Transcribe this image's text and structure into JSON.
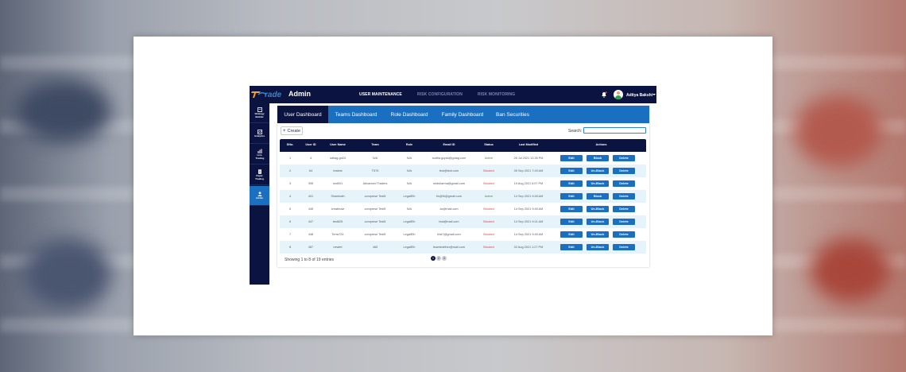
{
  "header": {
    "logo_text": "rade",
    "app_title": "Admin",
    "nav": [
      {
        "label": "USER MAINTENANCE",
        "active": true
      },
      {
        "label": "RISK CONFIGURATION",
        "active": false
      },
      {
        "label": "RISK MONITORING",
        "active": false
      }
    ],
    "user_name": "Aditya Bakshi"
  },
  "sidebar": {
    "items": [
      {
        "label": "Strategy Builder",
        "icon": "builder-icon",
        "active": false
      },
      {
        "label": "Analytics",
        "icon": "analytics-icon",
        "active": false
      },
      {
        "label": "Live Trading",
        "icon": "chart-icon",
        "active": false
      },
      {
        "label": "Paper Trading",
        "icon": "paper-icon",
        "active": false
      },
      {
        "label": "Admin",
        "icon": "admin-icon",
        "active": true
      }
    ]
  },
  "tabs": [
    {
      "label": "User Dashboard",
      "active": true
    },
    {
      "label": "Teams Dashboard",
      "active": false
    },
    {
      "label": "Role Dashboard",
      "active": false
    },
    {
      "label": "Family Dashboard",
      "active": false
    },
    {
      "label": "Ban Securities",
      "active": false
    }
  ],
  "toolbar": {
    "create_label": "Create",
    "search_label": "Search:",
    "search_value": ""
  },
  "table": {
    "columns": [
      "SNo.",
      "User ID",
      "User Name",
      "Team",
      "Role",
      "Email ID",
      "Status",
      "Last Modified",
      "Actions"
    ],
    "rows": [
      {
        "sno": "1",
        "user_id": "4",
        "user_name": "sdhag.gu03",
        "team": "N/A",
        "role": "N/A",
        "email": "sudha.gupta@gutag.com",
        "status": "Active",
        "last_modified": "28 Jul 2021 12:35 PM",
        "block_label": "Block"
      },
      {
        "sno": "2",
        "user_id": "64",
        "user_name": "testest",
        "team": "T575",
        "role": "N/A",
        "email": "test@test.com",
        "status": "Blocked",
        "last_modified": "05 Sep 2021 7:49 AM",
        "block_label": "Un-Block"
      },
      {
        "sno": "3",
        "user_id": "395",
        "user_name": "xed001",
        "team": "Advanced Traders",
        "role": "N/A",
        "email": "sridsharma@gmail.com",
        "status": "Blocked",
        "last_modified": "19 Aug 2021 6:07 PM",
        "block_label": "Un-Block"
      },
      {
        "sno": "4",
        "user_id": "401",
        "user_name": "Shanteath",
        "team": "comprese Test5",
        "role": "LegalEth",
        "email": "fin@th@gmail.com",
        "status": "Active",
        "last_modified": "14 Sep 2021 9:45 AM",
        "block_label": "Block"
      },
      {
        "sno": "5",
        "user_id": "445",
        "user_name": "createuse",
        "team": "comprese Test5",
        "role": "N/A",
        "email": "ac@mail.com",
        "status": "Blocked",
        "last_modified": "14 Sep 2021 9:45 AM",
        "block_label": "Un-Block"
      },
      {
        "sno": "6",
        "user_id": "447",
        "user_name": "test625",
        "team": "comprese Test5",
        "role": "LegalEth",
        "email": "test@mail.com",
        "status": "Blocked",
        "last_modified": "14 Sep 2021 9:41 AM",
        "block_label": "Un-Block"
      },
      {
        "sno": "7",
        "user_id": "448",
        "user_name": "Terra724",
        "team": "comprese Test5",
        "role": "LegalEth",
        "email": "test7@gmail.com",
        "status": "Blocked",
        "last_modified": "14 Sep 2021 9:45 AM",
        "block_label": "Un-Block"
      },
      {
        "sno": "8",
        "user_id": "467",
        "user_name": "newtet",
        "team": "465",
        "role": "LegalEth",
        "email": "teamtestther@mail.com",
        "status": "Blocked",
        "last_modified": "02 Aug 2021 1:27 PM",
        "block_label": "Un-Block"
      }
    ],
    "edit_label": "Edit",
    "delete_label": "Delete"
  },
  "footer": {
    "showing_text": "Showing 1 to 8 of 19 entries",
    "pages": [
      "1",
      "2",
      "3"
    ],
    "active_page": "1"
  },
  "colors": {
    "navy": "#0b1440",
    "accent": "#1a6fc0",
    "row_alt": "#e6f3fb",
    "blocked": "#e04444",
    "active": "#4b8a3f"
  }
}
